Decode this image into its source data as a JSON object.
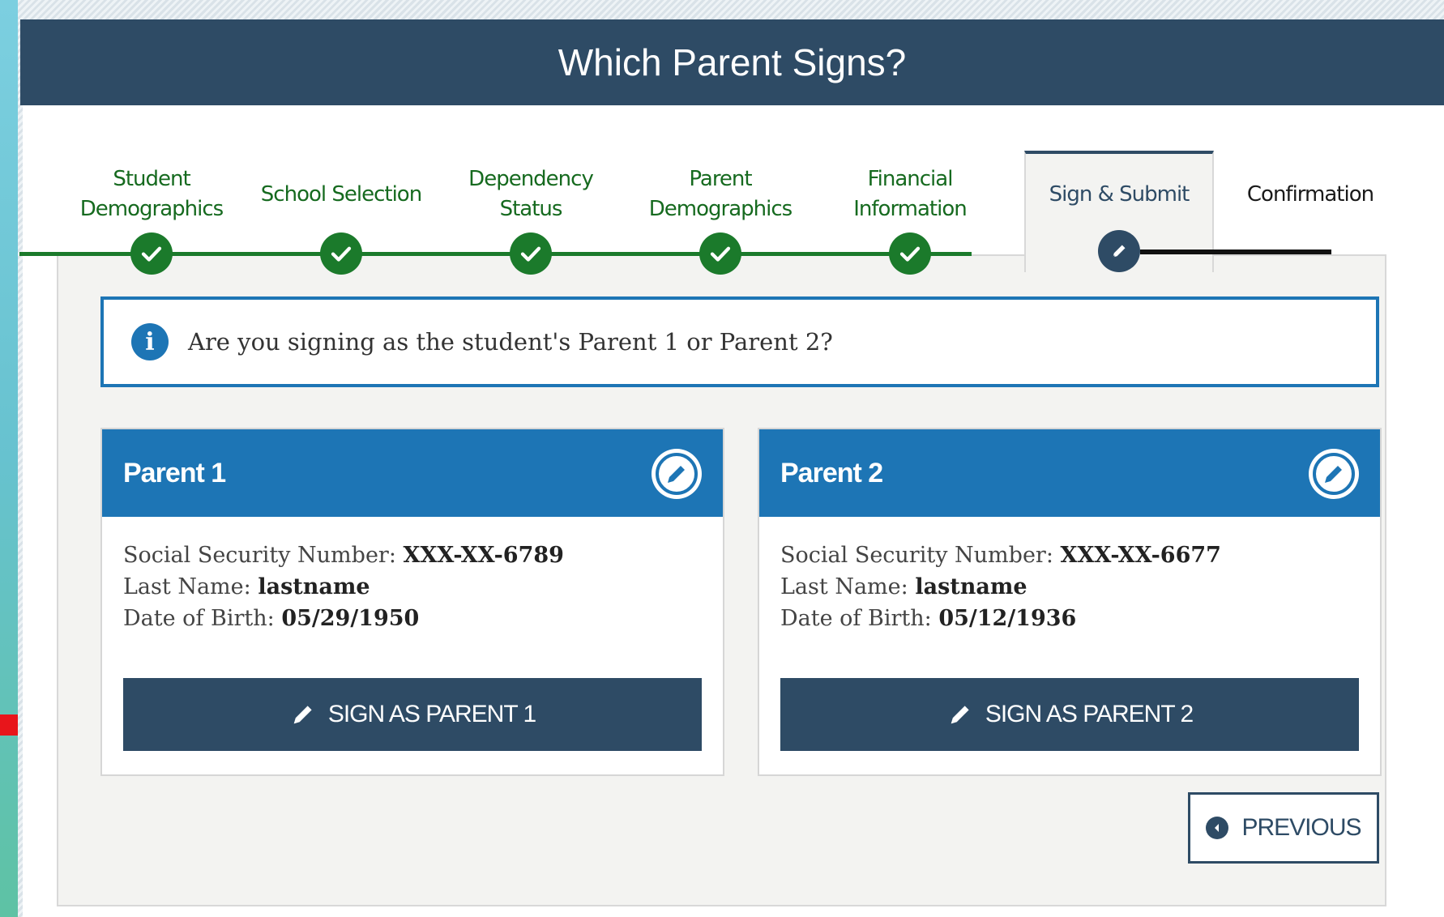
{
  "header": {
    "title": "Which Parent Signs?"
  },
  "steps": [
    {
      "label": "Student Demographics",
      "status": "complete"
    },
    {
      "label": "School Selection",
      "status": "complete"
    },
    {
      "label": "Dependency Status",
      "status": "complete"
    },
    {
      "label": "Parent Demographics",
      "status": "complete"
    },
    {
      "label": "Financial Information",
      "status": "complete"
    },
    {
      "label": "Sign & Submit",
      "status": "active"
    },
    {
      "label": "Confirmation",
      "status": "upcoming"
    }
  ],
  "alert": {
    "message": "Are you signing as the student's Parent 1 or Parent 2?"
  },
  "parents": [
    {
      "title": "Parent 1",
      "ssn_label": "Social Security Number:",
      "ssn": "XXX-XX-6789",
      "last_name_label": "Last Name:",
      "last_name": "lastname",
      "dob_label": "Date of Birth:",
      "dob": "05/29/1950",
      "button": "SIGN AS PARENT 1"
    },
    {
      "title": "Parent 2",
      "ssn_label": "Social Security Number:",
      "ssn": "XXX-XX-6677",
      "last_name_label": "Last Name:",
      "last_name": "lastname",
      "dob_label": "Date of Birth:",
      "dob": "05/12/1936",
      "button": "SIGN AS PARENT 2"
    }
  ],
  "previous_button": "PREVIOUS",
  "colors": {
    "navy": "#2e4b65",
    "blue": "#1d75b5",
    "green": "#1b7a2b",
    "annotation_red": "#e8151b"
  },
  "icons": {
    "complete": "check-icon",
    "active": "pencil-icon",
    "alert": "info-icon",
    "card": "seal-pencil-icon",
    "previous": "arrow-left-circle-icon"
  }
}
